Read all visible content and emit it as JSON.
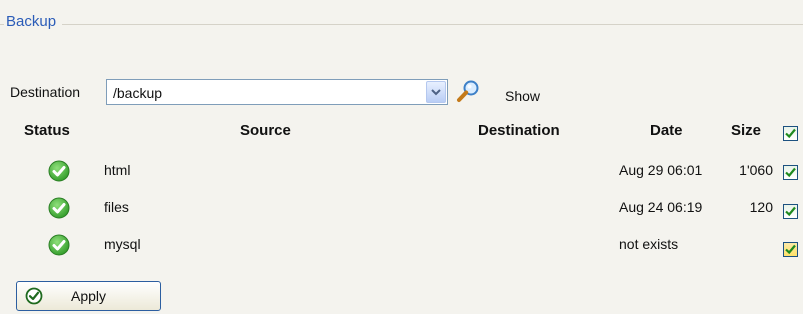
{
  "fieldset": {
    "legend": "Backup"
  },
  "destination": {
    "label": "Destination",
    "value": "/backup",
    "show_label": "Show"
  },
  "table": {
    "headers": {
      "status": "Status",
      "source": "Source",
      "destination": "Destination",
      "date": "Date",
      "size": "Size"
    },
    "rows": [
      {
        "status": "ok",
        "source": "html",
        "destination": "",
        "date": "Aug 29 06:01",
        "size": "1'060",
        "checked": true
      },
      {
        "status": "ok",
        "source": "files",
        "destination": "",
        "date": "Aug 24 06:19",
        "size": "120",
        "checked": true
      },
      {
        "status": "ok",
        "source": "mysql",
        "destination": "",
        "date": "not exists",
        "size": "",
        "checked": true
      }
    ]
  },
  "apply": {
    "label": "Apply"
  },
  "colors": {
    "legend": "#2b5cb8",
    "ok_green": "#3aa531",
    "check_green": "#1f8a1f",
    "border_blue": "#7f9db9"
  },
  "icons": {
    "status": "check-circle-icon",
    "search": "magnifier-icon",
    "dropdown": "chevron-down-icon"
  }
}
